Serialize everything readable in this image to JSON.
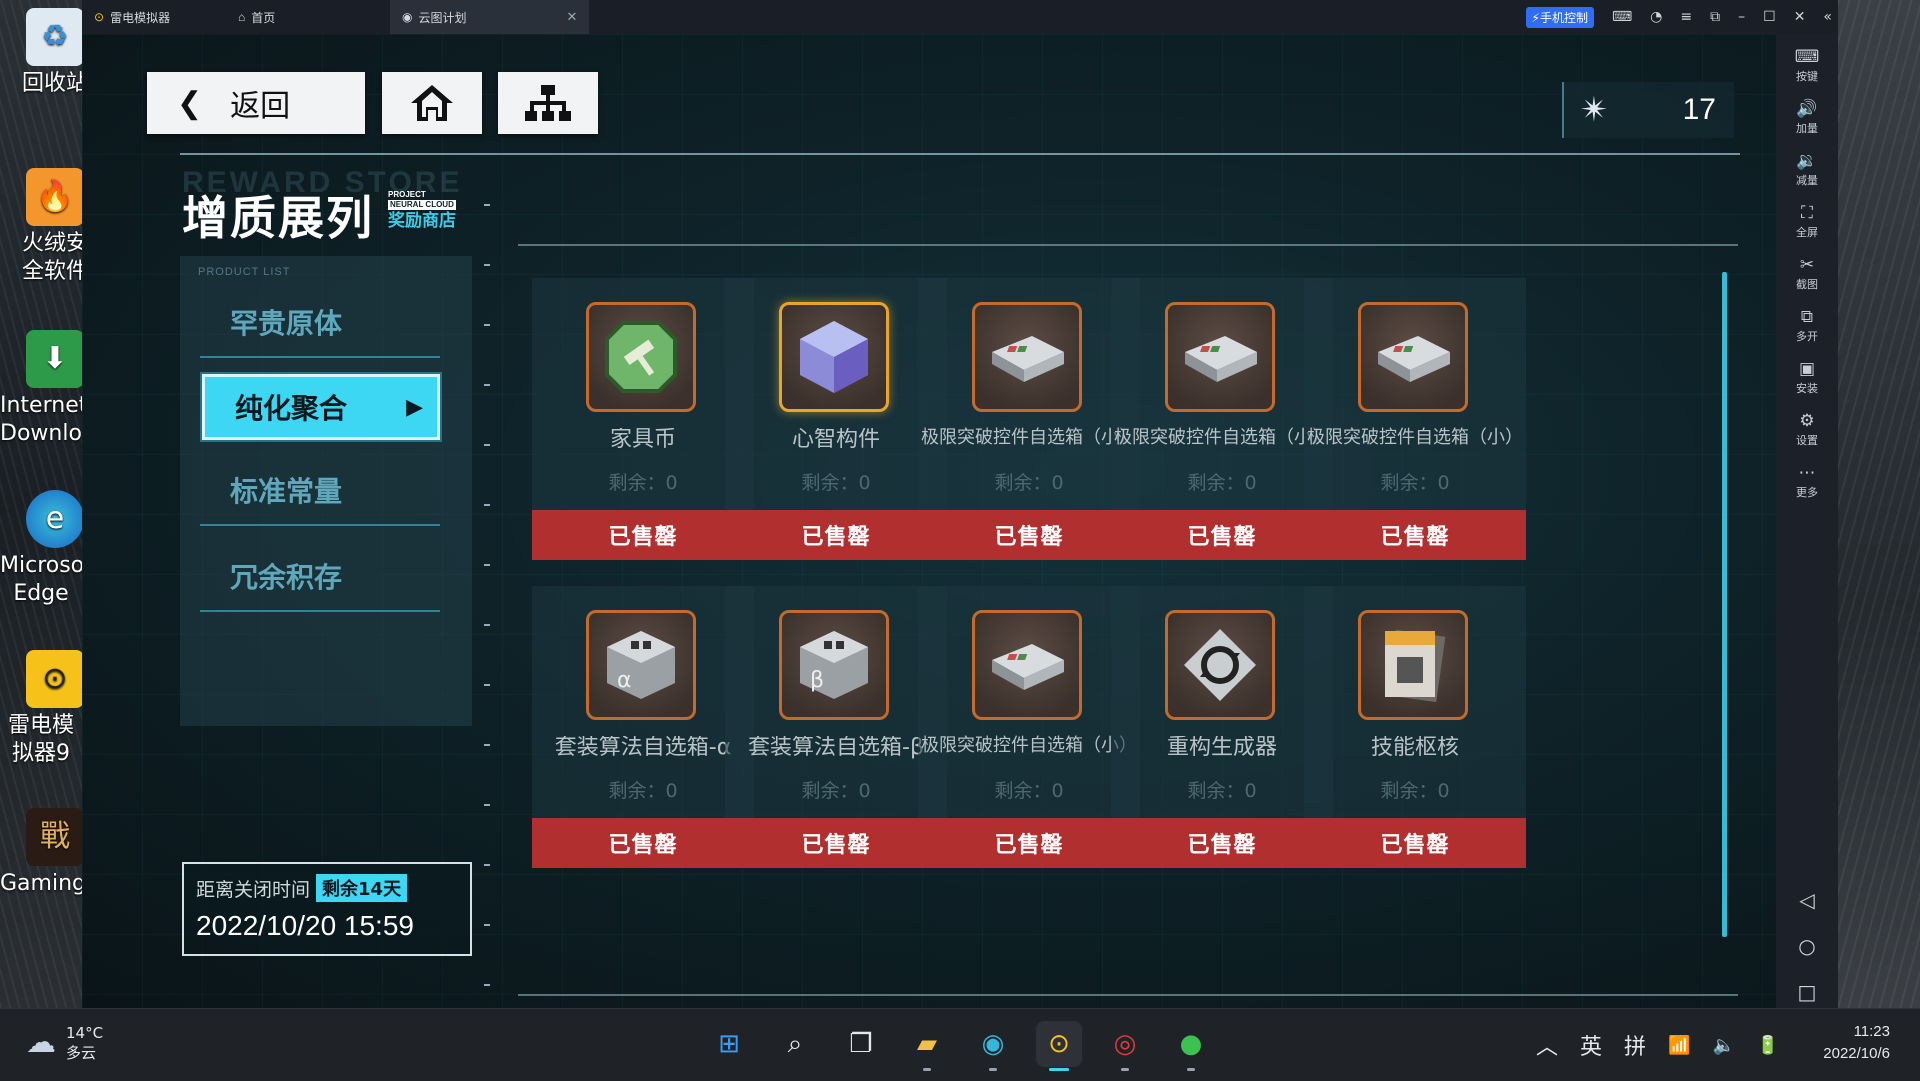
{
  "desktop": {
    "icons": [
      {
        "label": "回收站",
        "icon": "recycle-bin-icon"
      },
      {
        "label": "火绒安全软件",
        "icon": "huorong-icon"
      },
      {
        "label": "Internet Download",
        "icon": "idm-icon"
      },
      {
        "label": "Microsoft Edge",
        "icon": "edge-icon"
      },
      {
        "label": "雷电模拟器9",
        "icon": "ldplayer-icon"
      },
      {
        "label": "Gaming",
        "icon": "gaming-icon"
      }
    ]
  },
  "emulator": {
    "tabs": [
      {
        "label": "雷电模拟器"
      },
      {
        "label": "首页"
      },
      {
        "label": "云图计划"
      }
    ],
    "phone_control": "手机控制",
    "sidebar": [
      {
        "label": "按键",
        "icon": "keyboard-icon"
      },
      {
        "label": "加量",
        "icon": "volume-up-icon"
      },
      {
        "label": "减量",
        "icon": "volume-down-icon"
      },
      {
        "label": "全屏",
        "icon": "fullscreen-icon"
      },
      {
        "label": "截图",
        "icon": "scissors-icon"
      },
      {
        "label": "多开",
        "icon": "multi-instance-icon"
      },
      {
        "label": "安装",
        "icon": "apk-install-icon"
      },
      {
        "label": "设置",
        "icon": "settings-icon"
      },
      {
        "label": "更多",
        "icon": "more-icon"
      }
    ]
  },
  "game": {
    "back_label": "返回",
    "currency_value": "17",
    "title_bg": "REWARD STORE",
    "title": "增质展列",
    "title_tag_1": "PROJECT",
    "title_tag_2": "NEURAL CLOUD",
    "title_tag_3": "奖励商店",
    "category_header": "PRODUCT LIST",
    "categories": [
      {
        "label": "罕贵原体",
        "active": false
      },
      {
        "label": "纯化聚合",
        "active": true
      },
      {
        "label": "标准常量",
        "active": false
      },
      {
        "label": "冗余积存",
        "active": false
      }
    ],
    "timer": {
      "label": "距离关闭时间",
      "badge": "剩余14天",
      "date": "2022/10/20 15:59"
    },
    "items": [
      {
        "name": "家具币",
        "remain": "剩余：0",
        "status": "已售罄",
        "icon": "furniture-coin-icon"
      },
      {
        "name": "心智构件",
        "remain": "剩余：0",
        "status": "已售罄",
        "icon": "mind-cube-icon"
      },
      {
        "name": "极限突破控件自选箱（小）",
        "remain": "剩余：0",
        "status": "已售罄",
        "icon": "chip-box-icon"
      },
      {
        "name": "极限突破控件自选箱（小）",
        "remain": "剩余：0",
        "status": "已售罄",
        "icon": "chip-box-icon"
      },
      {
        "name": "极限突破控件自选箱（小）",
        "remain": "剩余：0",
        "status": "已售罄",
        "icon": "chip-box-icon"
      },
      {
        "name": "套装算法自选箱-α",
        "remain": "剩余：0",
        "status": "已售罄",
        "icon": "algorithm-box-alpha-icon"
      },
      {
        "name": "套装算法自选箱-β",
        "remain": "剩余：0",
        "status": "已售罄",
        "icon": "algorithm-box-beta-icon"
      },
      {
        "name": "极限突破控件自选箱（小）",
        "remain": "剩余：0",
        "status": "已售罄",
        "icon": "chip-box-icon"
      },
      {
        "name": "重构生成器",
        "remain": "剩余：0",
        "status": "已售罄",
        "icon": "reconstruct-generator-icon"
      },
      {
        "name": "技能枢核",
        "remain": "剩余：0",
        "status": "已售罄",
        "icon": "skill-core-icon"
      }
    ]
  },
  "taskbar": {
    "temperature": "14°C",
    "weather": "多云",
    "ime_lang": "英",
    "ime_mode": "拼",
    "time": "11:23",
    "date": "2022/10/6"
  }
}
